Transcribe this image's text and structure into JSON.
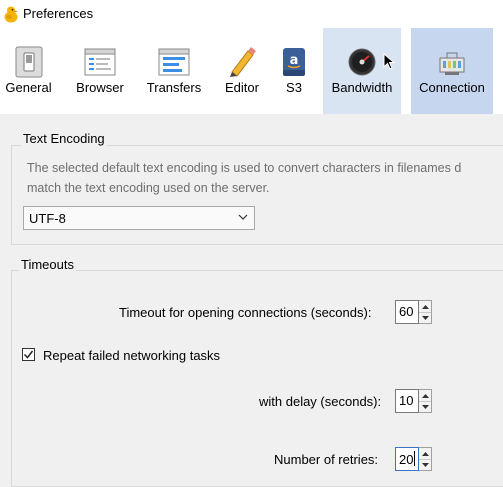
{
  "window": {
    "title": "Preferences"
  },
  "toolbar": {
    "items": [
      {
        "label": "General",
        "icon": "general-switch-icon"
      },
      {
        "label": "Browser",
        "icon": "browser-window-icon"
      },
      {
        "label": "Transfers",
        "icon": "transfers-window-icon"
      },
      {
        "label": "Editor",
        "icon": "pencil-icon"
      },
      {
        "label": "S3",
        "icon": "amazon-s3-icon"
      },
      {
        "label": "Bandwidth",
        "icon": "speedometer-icon"
      },
      {
        "label": "Connection",
        "icon": "network-card-icon"
      }
    ],
    "selected": "Connection"
  },
  "text_encoding": {
    "title": "Text Encoding",
    "description_line1": "The selected default text encoding is used to convert characters in filenames d",
    "description_line2": "match the text encoding used on the server.",
    "selected_value": "UTF-8"
  },
  "timeouts": {
    "title": "Timeouts",
    "open_timeout_label": "Timeout for opening connections (seconds):",
    "open_timeout_value": "60",
    "repeat_label": "Repeat failed networking tasks",
    "repeat_checked": true,
    "delay_label": "with delay (seconds):",
    "delay_value": "10",
    "retries_label": "Number of retries:",
    "retries_value": "20"
  }
}
